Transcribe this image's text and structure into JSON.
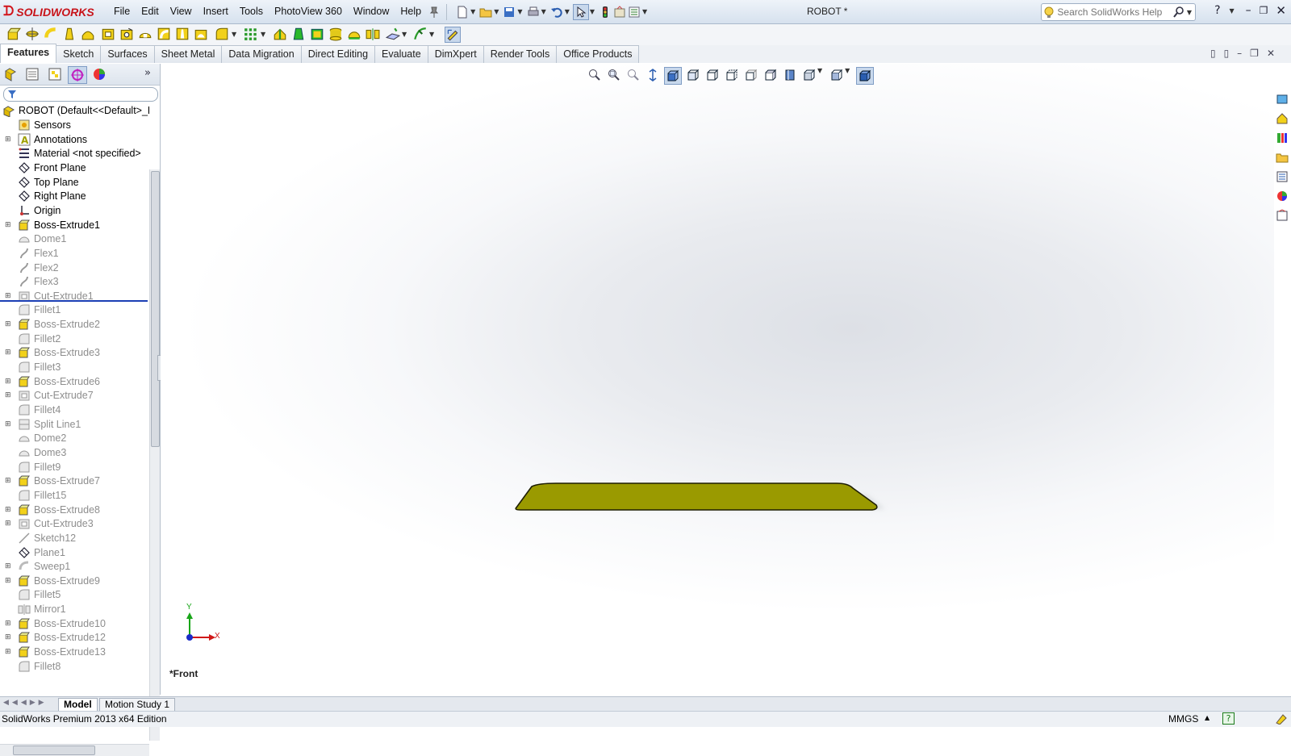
{
  "app": {
    "logo": "SOLIDWORKS",
    "document_title": "ROBOT *"
  },
  "menu": [
    "File",
    "Edit",
    "View",
    "Insert",
    "Tools",
    "PhotoView 360",
    "Window",
    "Help"
  ],
  "help_search": {
    "placeholder": "Search SolidWorks Help"
  },
  "tabs": [
    {
      "label": "Features",
      "active": true
    },
    {
      "label": "Sketch"
    },
    {
      "label": "Surfaces"
    },
    {
      "label": "Sheet Metal"
    },
    {
      "label": "Data Migration"
    },
    {
      "label": "Direct Editing"
    },
    {
      "label": "Evaluate"
    },
    {
      "label": "DimXpert"
    },
    {
      "label": "Render Tools"
    },
    {
      "label": "Office Products"
    }
  ],
  "tree": {
    "root": "ROBOT  (Default<<Default>_D",
    "items": [
      {
        "label": "Sensors",
        "icon": "sensor-icon",
        "exp": false,
        "sup": false
      },
      {
        "label": "Annotations",
        "icon": "annotation-icon",
        "exp": true,
        "sup": false
      },
      {
        "label": "Material <not specified>",
        "icon": "material-icon",
        "exp": false,
        "sup": false
      },
      {
        "label": "Front Plane",
        "icon": "plane-icon",
        "exp": false,
        "sup": false
      },
      {
        "label": "Top Plane",
        "icon": "plane-icon",
        "exp": false,
        "sup": false
      },
      {
        "label": "Right Plane",
        "icon": "plane-icon",
        "exp": false,
        "sup": false
      },
      {
        "label": "Origin",
        "icon": "origin-icon",
        "exp": false,
        "sup": false
      },
      {
        "label": "Boss-Extrude1",
        "icon": "extrude-icon",
        "exp": true,
        "sup": false
      },
      {
        "label": "Dome1",
        "icon": "dome-icon",
        "exp": false,
        "sup": true
      },
      {
        "label": "Flex1",
        "icon": "flex-icon",
        "exp": false,
        "sup": true
      },
      {
        "label": "Flex2",
        "icon": "flex-icon",
        "exp": false,
        "sup": true
      },
      {
        "label": "Flex3",
        "icon": "flex-icon",
        "exp": false,
        "sup": true
      },
      {
        "label": "Cut-Extrude1",
        "icon": "cut-icon",
        "exp": true,
        "sup": true
      },
      {
        "label": "Fillet1",
        "icon": "fillet-icon",
        "exp": false,
        "sup": true
      },
      {
        "label": "Boss-Extrude2",
        "icon": "extrude-icon",
        "exp": true,
        "sup": true
      },
      {
        "label": "Fillet2",
        "icon": "fillet-icon",
        "exp": false,
        "sup": true
      },
      {
        "label": "Boss-Extrude3",
        "icon": "extrude-icon",
        "exp": true,
        "sup": true
      },
      {
        "label": "Fillet3",
        "icon": "fillet-icon",
        "exp": false,
        "sup": true
      },
      {
        "label": "Boss-Extrude6",
        "icon": "extrude-icon",
        "exp": true,
        "sup": true
      },
      {
        "label": "Cut-Extrude7",
        "icon": "cut-icon",
        "exp": true,
        "sup": true
      },
      {
        "label": "Fillet4",
        "icon": "fillet-icon",
        "exp": false,
        "sup": true
      },
      {
        "label": "Split Line1",
        "icon": "split-icon",
        "exp": true,
        "sup": true
      },
      {
        "label": "Dome2",
        "icon": "dome-icon",
        "exp": false,
        "sup": true
      },
      {
        "label": "Dome3",
        "icon": "dome-icon",
        "exp": false,
        "sup": true
      },
      {
        "label": "Fillet9",
        "icon": "fillet-icon",
        "exp": false,
        "sup": true
      },
      {
        "label": "Boss-Extrude7",
        "icon": "extrude-icon",
        "exp": true,
        "sup": true
      },
      {
        "label": "Fillet15",
        "icon": "fillet-icon",
        "exp": false,
        "sup": true
      },
      {
        "label": "Boss-Extrude8",
        "icon": "extrude-icon",
        "exp": true,
        "sup": true
      },
      {
        "label": "Cut-Extrude3",
        "icon": "cut-icon",
        "exp": true,
        "sup": true
      },
      {
        "label": "Sketch12",
        "icon": "sketch-icon",
        "exp": false,
        "sup": true
      },
      {
        "label": "Plane1",
        "icon": "plane-icon",
        "exp": false,
        "sup": true
      },
      {
        "label": "Sweep1",
        "icon": "sweep-icon",
        "exp": true,
        "sup": true
      },
      {
        "label": "Boss-Extrude9",
        "icon": "extrude-icon",
        "exp": true,
        "sup": true
      },
      {
        "label": "Fillet5",
        "icon": "fillet-icon",
        "exp": false,
        "sup": true
      },
      {
        "label": "Mirror1",
        "icon": "mirror-icon",
        "exp": false,
        "sup": true
      },
      {
        "label": "Boss-Extrude10",
        "icon": "extrude-icon",
        "exp": true,
        "sup": true
      },
      {
        "label": "Boss-Extrude12",
        "icon": "extrude-icon",
        "exp": true,
        "sup": true
      },
      {
        "label": "Boss-Extrude13",
        "icon": "extrude-icon",
        "exp": true,
        "sup": true
      },
      {
        "label": "Fillet8",
        "icon": "fillet-icon",
        "exp": false,
        "sup": true
      }
    ]
  },
  "viewport": {
    "view_label": "*Front",
    "triad_x": "X",
    "triad_y": "Y",
    "part_color": "#9a9a00"
  },
  "bottom_tabs": [
    {
      "label": "Model",
      "active": true
    },
    {
      "label": "Motion Study 1"
    }
  ],
  "status": {
    "left": "SolidWorks Premium 2013 x64 Edition",
    "units": "MMGS",
    "units_caret": "▲"
  },
  "colors": {
    "rollback_bar": "#1c3fb5",
    "logo_red": "#d2141a"
  }
}
